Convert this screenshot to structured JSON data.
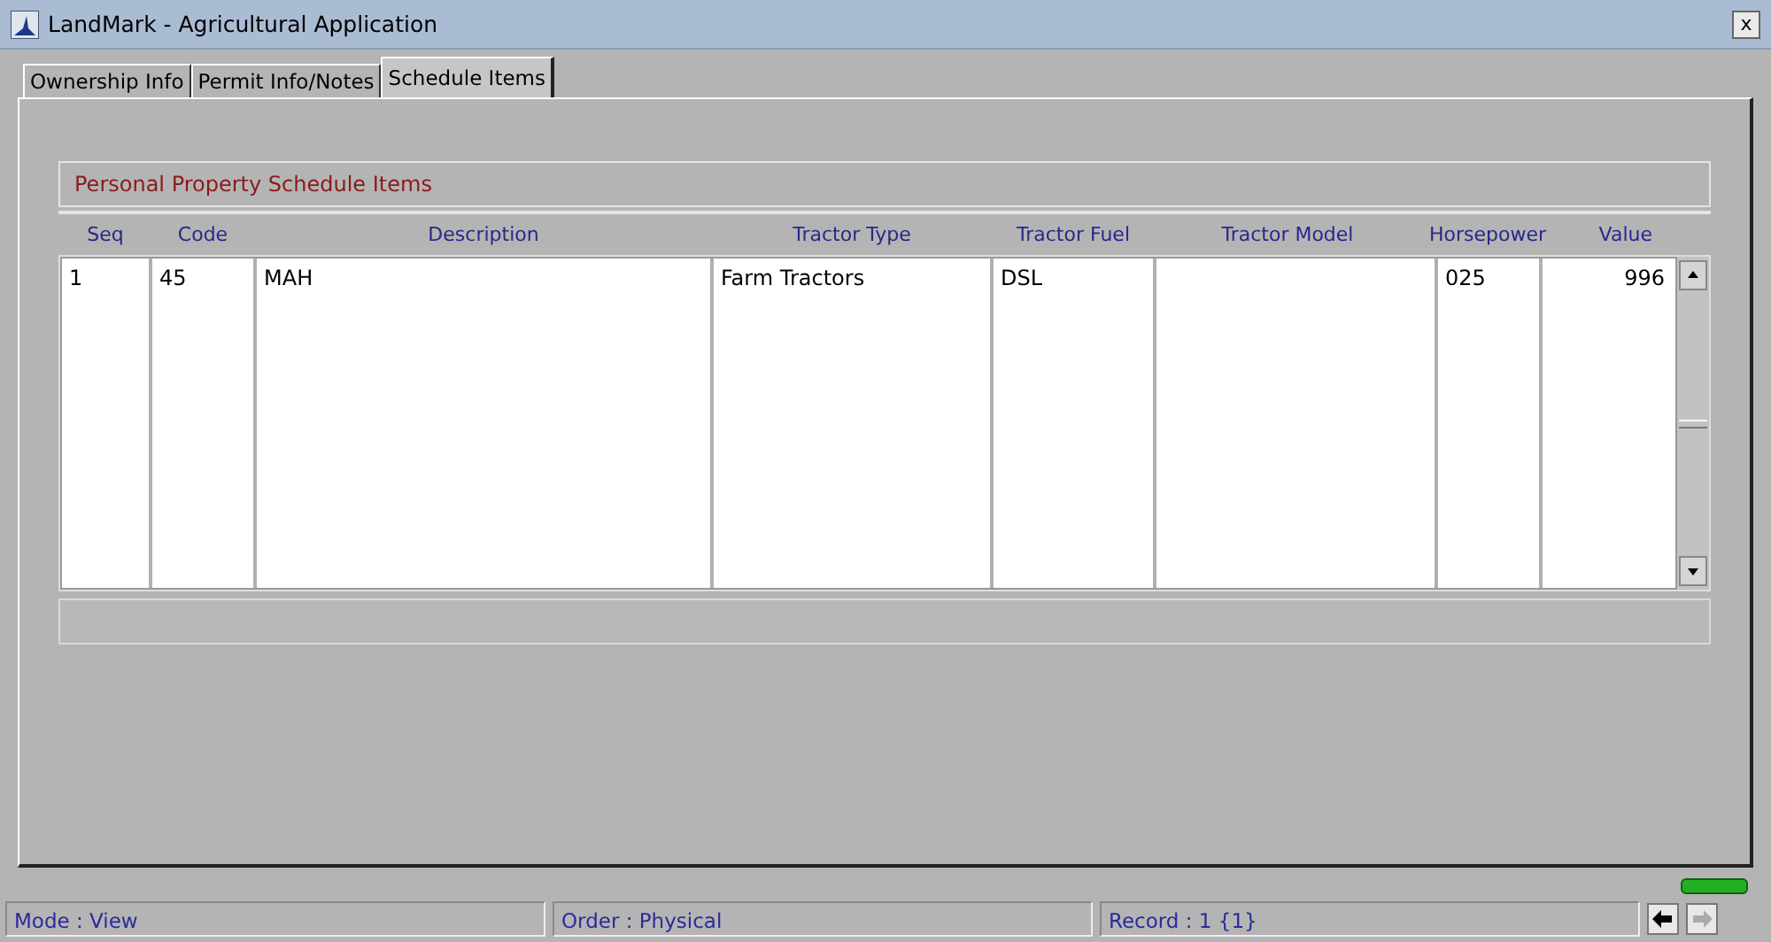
{
  "window": {
    "title": "LandMark - Agricultural Application",
    "close": "x"
  },
  "tabs": [
    {
      "label": "Ownership Info",
      "selected": false
    },
    {
      "label": "Permit Info/Notes",
      "selected": false
    },
    {
      "label": "Schedule Items",
      "selected": true
    }
  ],
  "group": {
    "title": "Personal Property Schedule Items"
  },
  "table": {
    "columns": [
      "Seq",
      "Code",
      "Description",
      "Tractor Type",
      "Tractor Fuel",
      "Tractor Model",
      "Horsepower",
      "Value"
    ],
    "rows": [
      [
        "1",
        "45",
        "MAH",
        "Farm Tractors",
        "DSL",
        "",
        "025",
        "996"
      ]
    ]
  },
  "status_bar": {
    "fields": [
      "Mode : View",
      "Order : Physical",
      "Record : 1 {1}"
    ],
    "back_disabled": false,
    "forward_disabled": true
  }
}
